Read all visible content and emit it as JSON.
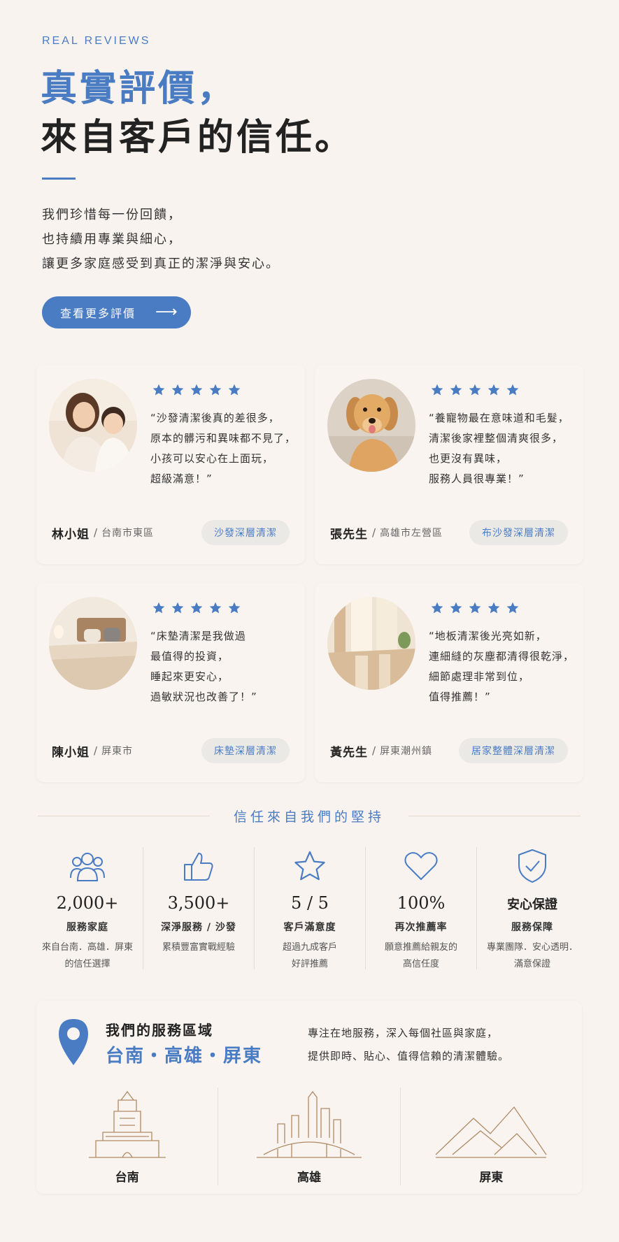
{
  "eyebrow": "REAL REVIEWS",
  "title": {
    "line1": "真實評價，",
    "line2": "來自客戶的信任。"
  },
  "intro": [
    "我們珍惜每一份回饋，",
    "也持續用專業與細心，",
    "讓更多家庭感受到真正的潔淨與安心。"
  ],
  "cta": {
    "label": "查看更多評價",
    "arrow": "⟶"
  },
  "colors": {
    "accent": "#4a7cc4",
    "background": "#f8f3ee"
  },
  "reviews": [
    {
      "photo": "mother-child-photo",
      "rating": 5,
      "quote": [
        "“沙發清潔後真的差很多，",
        "原本的髒污和異味都不見了，",
        "小孩可以安心在上面玩，",
        "超級滿意！”"
      ],
      "name": "林小姐",
      "separator": "/",
      "location": "台南市東區",
      "tag": "沙發深層清潔"
    },
    {
      "photo": "golden-retriever-photo",
      "rating": 5,
      "quote": [
        "“養寵物最在意味道和毛髮，",
        "清潔後家裡整個清爽很多，",
        "也更沒有異味，",
        "服務人員很專業！”"
      ],
      "name": "張先生",
      "separator": "/",
      "location": "高雄市左營區",
      "tag": "布沙發深層清潔"
    },
    {
      "photo": "bedroom-photo",
      "rating": 5,
      "quote": [
        "“床墊清潔是我做過",
        "最值得的投資，",
        "睡起來更安心，",
        "過敏狀況也改善了！”"
      ],
      "name": "陳小姐",
      "separator": "/",
      "location": "屏東市",
      "tag": "床墊深層清潔"
    },
    {
      "photo": "shiny-floor-photo",
      "rating": 5,
      "quote": [
        "“地板清潔後光亮如新，",
        "連細縫的灰塵都清得很乾淨，",
        "細節處理非常到位，",
        "值得推薦！”"
      ],
      "name": "黃先生",
      "separator": "/",
      "location": "屏東潮州鎮",
      "tag": "居家整體深層清潔"
    }
  ],
  "trust": {
    "heading": "信任來自我們的堅持",
    "stats": [
      {
        "icon": "users-icon",
        "value": "2,000+",
        "label": "服務家庭",
        "desc": [
          "來自台南．高雄．屏東",
          "的信任選擇"
        ]
      },
      {
        "icon": "thumbs-up-icon",
        "value": "3,500+",
        "label": "深淨服務 / 沙發",
        "desc": [
          "累積豐富實戰經驗"
        ]
      },
      {
        "icon": "star-outline-icon",
        "value": "5 / 5",
        "label": "客戶滿意度",
        "desc": [
          "超過九成客戶",
          "好評推薦"
        ]
      },
      {
        "icon": "heart-icon",
        "value": "100%",
        "label": "再次推薦率",
        "desc": [
          "願意推薦給親友的",
          "高信任度"
        ]
      },
      {
        "icon": "shield-check-icon",
        "value": "安心保證",
        "label": "服務保障",
        "desc": [
          "專業團隊．安心透明．",
          "滿意保證"
        ]
      }
    ]
  },
  "service_area": {
    "subtitle": "我們的服務區域",
    "cities_headline": "台南・高雄・屏東",
    "blurb": [
      "專注在地服務，深入每個社區與家庭，",
      "提供即時、貼心、值得信賴的清潔體驗。"
    ],
    "cities": [
      {
        "name": "台南",
        "icon": "tainan-tower-illustration"
      },
      {
        "name": "高雄",
        "icon": "kaohsiung-skyline-illustration"
      },
      {
        "name": "屏東",
        "icon": "pingtung-mountains-illustration"
      }
    ]
  }
}
